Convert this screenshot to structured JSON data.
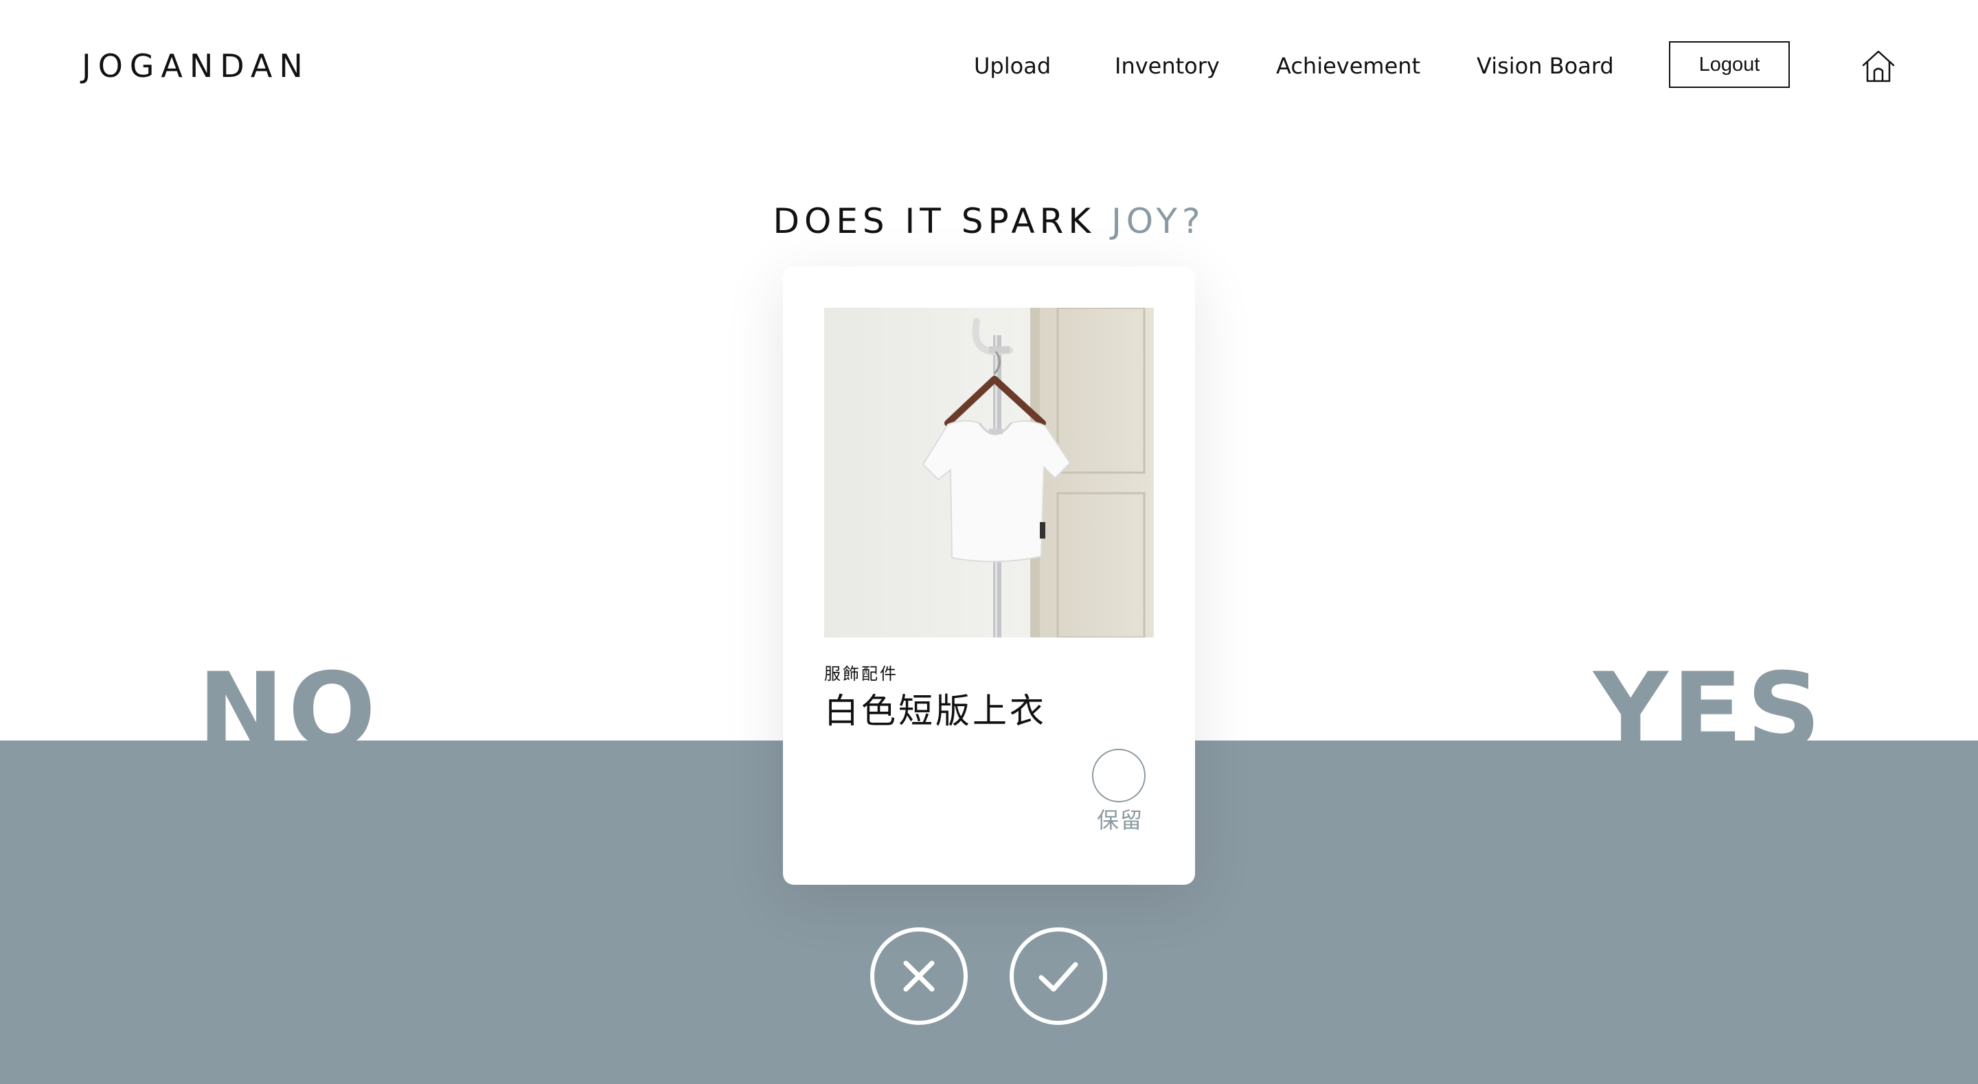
{
  "app": {
    "logo": "JOGANDAN"
  },
  "nav": {
    "upload": "Upload",
    "inventory": "Inventory",
    "achievement": "Achievement",
    "vision_board": "Vision Board",
    "logout": "Logout",
    "home_icon": "home-icon"
  },
  "main": {
    "title_prefix": "DOES IT SPARK ",
    "title_accent": "JOY?",
    "no_label": "NO",
    "yes_label": "YES",
    "accent_color": "#8a9aa2"
  },
  "card": {
    "photo_alt": "white cropped t-shirt on wooden hanger",
    "category": "服飾配件",
    "item_name": "白色短版上衣",
    "keep_label": "保留"
  },
  "actions": {
    "reject_icon": "x-icon",
    "accept_icon": "check-icon"
  }
}
